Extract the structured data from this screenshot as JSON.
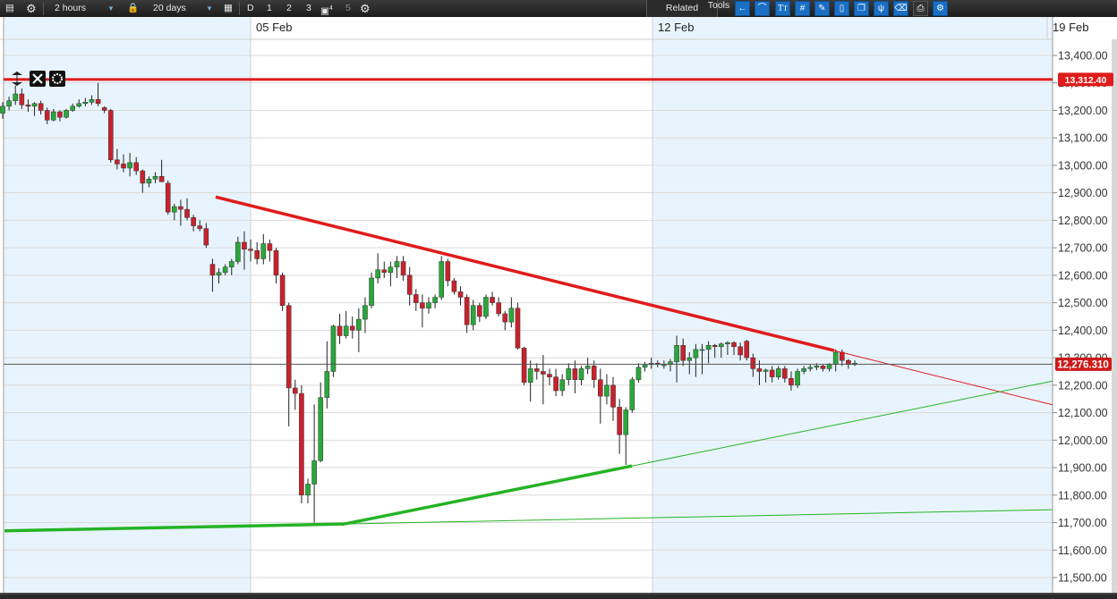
{
  "toolbar": {
    "interval": "2 hours",
    "range": "20 days",
    "period_d": "D",
    "period_1": "1",
    "period_2": "2",
    "period_3": "3",
    "period_4_sup": "4",
    "period_5": "5",
    "related": "Related",
    "tools": "Tools",
    "tool_icons": [
      "arrow-left-icon",
      "curve-icon",
      "text-tool-icon",
      "crosshair-grid-icon",
      "pencil-icon",
      "candles-icon",
      "layers-icon",
      "fork-icon",
      "eraser-icon",
      "print-icon",
      "settings-pin-icon"
    ]
  },
  "colors": {
    "bull": "#29a83a",
    "bear": "#c8222c",
    "resistance": "#e01b1b",
    "support": "#25b325",
    "shade": "#e8f4fd",
    "grid": "#dadada"
  },
  "chart_data": {
    "type": "candlestick",
    "x_labels": [
      "05 Feb",
      "12 Feb",
      "19 Feb"
    ],
    "ylim": [
      11440,
      13470
    ],
    "yticks": [
      11500,
      11600,
      11700,
      11800,
      11900,
      12000,
      12100,
      12200,
      12300,
      12400,
      12500,
      12600,
      12700,
      12800,
      12900,
      13000,
      13100,
      13200,
      13300,
      13400
    ],
    "ytick_labels": [
      "11,500.00",
      "11,600.00",
      "11,700.00",
      "11,800.00",
      "11,900.00",
      "12,000.00",
      "12,100.00",
      "12,200.00",
      "12,300.00",
      "12,400.00",
      "12,500.00",
      "12,600.00",
      "12,700.00",
      "12,800.00",
      "12,900.00",
      "13,000.00",
      "13,100.00",
      "13,200.00",
      "13,300.00",
      "13,400.00"
    ],
    "horizontal_line": {
      "value": 13312.4,
      "label": "13,312.40"
    },
    "last_price": {
      "value": 12276.31,
      "label": "12,276.310"
    },
    "candles": [
      [
        13190,
        13230,
        13170,
        13215
      ],
      [
        13215,
        13250,
        13200,
        13235
      ],
      [
        13235,
        13290,
        13220,
        13260
      ],
      [
        13260,
        13280,
        13205,
        13220
      ],
      [
        13220,
        13240,
        13195,
        13215
      ],
      [
        13215,
        13230,
        13180,
        13225
      ],
      [
        13225,
        13235,
        13185,
        13200
      ],
      [
        13200,
        13210,
        13150,
        13165
      ],
      [
        13165,
        13205,
        13160,
        13195
      ],
      [
        13195,
        13200,
        13160,
        13175
      ],
      [
        13175,
        13205,
        13170,
        13200
      ],
      [
        13200,
        13225,
        13195,
        13215
      ],
      [
        13215,
        13240,
        13210,
        13225
      ],
      [
        13225,
        13245,
        13215,
        13230
      ],
      [
        13230,
        13255,
        13220,
        13240
      ],
      [
        13240,
        13300,
        13215,
        13225
      ],
      [
        13210,
        13215,
        13190,
        13200
      ],
      [
        13200,
        13205,
        13010,
        13020
      ],
      [
        13020,
        13060,
        12985,
        13005
      ],
      [
        13005,
        13040,
        12975,
        12990
      ],
      [
        12990,
        13045,
        12960,
        13010
      ],
      [
        13010,
        13030,
        12965,
        12980
      ],
      [
        12980,
        12985,
        12900,
        12935
      ],
      [
        12935,
        12960,
        12920,
        12950
      ],
      [
        12950,
        12975,
        12935,
        12960
      ],
      [
        12960,
        13020,
        12950,
        12940
      ],
      [
        12935,
        12945,
        12820,
        12830
      ],
      [
        12830,
        12860,
        12800,
        12850
      ],
      [
        12850,
        12875,
        12780,
        12840
      ],
      [
        12840,
        12880,
        12800,
        12810
      ],
      [
        12810,
        12820,
        12760,
        12780
      ],
      [
        12780,
        12800,
        12760,
        12770
      ],
      [
        12770,
        12790,
        12700,
        12710
      ],
      [
        12640,
        12660,
        12540,
        12600
      ],
      [
        12600,
        12625,
        12570,
        12610
      ],
      [
        12610,
        12640,
        12600,
        12630
      ],
      [
        12630,
        12660,
        12600,
        12650
      ],
      [
        12650,
        12740,
        12640,
        12720
      ],
      [
        12720,
        12760,
        12620,
        12695
      ],
      [
        12695,
        12730,
        12650,
        12690
      ],
      [
        12690,
        12720,
        12640,
        12660
      ],
      [
        12660,
        12750,
        12640,
        12715
      ],
      [
        12715,
        12730,
        12650,
        12690
      ],
      [
        12690,
        12700,
        12570,
        12600
      ],
      [
        12600,
        12610,
        12470,
        12490
      ],
      [
        12490,
        12500,
        12050,
        12190
      ],
      [
        12190,
        12220,
        12110,
        12170
      ],
      [
        12170,
        12200,
        11770,
        11800
      ],
      [
        11800,
        11860,
        11770,
        11840
      ],
      [
        11840,
        12130,
        11700,
        11925
      ],
      [
        11925,
        12210,
        11920,
        12155
      ],
      [
        12155,
        12360,
        12115,
        12250
      ],
      [
        12250,
        12420,
        12230,
        12415
      ],
      [
        12415,
        12460,
        12350,
        12380
      ],
      [
        12380,
        12470,
        12370,
        12415
      ],
      [
        12415,
        12450,
        12370,
        12400
      ],
      [
        12400,
        12480,
        12320,
        12440
      ],
      [
        12440,
        12520,
        12390,
        12490
      ],
      [
        12490,
        12610,
        12480,
        12590
      ],
      [
        12590,
        12680,
        12570,
        12620
      ],
      [
        12620,
        12650,
        12590,
        12610
      ],
      [
        12610,
        12650,
        12560,
        12630
      ],
      [
        12630,
        12670,
        12590,
        12650
      ],
      [
        12650,
        12670,
        12580,
        12600
      ],
      [
        12600,
        12630,
        12490,
        12530
      ],
      [
        12530,
        12550,
        12470,
        12500
      ],
      [
        12500,
        12530,
        12410,
        12480
      ],
      [
        12480,
        12520,
        12460,
        12500
      ],
      [
        12500,
        12530,
        12480,
        12520
      ],
      [
        12520,
        12670,
        12510,
        12650
      ],
      [
        12650,
        12660,
        12560,
        12580
      ],
      [
        12580,
        12590,
        12530,
        12540
      ],
      [
        12540,
        12560,
        12490,
        12520
      ],
      [
        12520,
        12530,
        12390,
        12420
      ],
      [
        12420,
        12510,
        12400,
        12490
      ],
      [
        12490,
        12500,
        12430,
        12450
      ],
      [
        12450,
        12530,
        12440,
        12520
      ],
      [
        12520,
        12540,
        12490,
        12500
      ],
      [
        12500,
        12520,
        12450,
        12460
      ],
      [
        12460,
        12470,
        12400,
        12430
      ],
      [
        12430,
        12520,
        12410,
        12480
      ],
      [
        12480,
        12500,
        12330,
        12335
      ],
      [
        12335,
        12340,
        12200,
        12210
      ],
      [
        12210,
        12290,
        12140,
        12260
      ],
      [
        12260,
        12280,
        12220,
        12250
      ],
      [
        12250,
        12310,
        12130,
        12240
      ],
      [
        12240,
        12260,
        12200,
        12230
      ],
      [
        12230,
        12260,
        12160,
        12180
      ],
      [
        12180,
        12240,
        12160,
        12220
      ],
      [
        12220,
        12280,
        12200,
        12260
      ],
      [
        12260,
        12290,
        12170,
        12220
      ],
      [
        12220,
        12270,
        12200,
        12260
      ],
      [
        12260,
        12300,
        12240,
        12270
      ],
      [
        12270,
        12290,
        12190,
        12220
      ],
      [
        12220,
        12260,
        12060,
        12160
      ],
      [
        12160,
        12240,
        12130,
        12200
      ],
      [
        12200,
        12230,
        12070,
        12120
      ],
      [
        12120,
        12150,
        11950,
        12020
      ],
      [
        12020,
        12120,
        11910,
        12110
      ],
      [
        12110,
        12230,
        12100,
        12220
      ],
      [
        12220,
        12280,
        12210,
        12265
      ],
      [
        12265,
        12285,
        12250,
        12275
      ],
      [
        12275,
        12300,
        12260,
        12280
      ],
      [
        12280,
        12290,
        12265,
        12275
      ],
      [
        12275,
        12290,
        12260,
        12275
      ],
      [
        12275,
        12295,
        12250,
        12285
      ],
      [
        12285,
        12380,
        12210,
        12345
      ],
      [
        12345,
        12370,
        12270,
        12290
      ],
      [
        12290,
        12320,
        12240,
        12300
      ],
      [
        12300,
        12350,
        12230,
        12330
      ],
      [
        12330,
        12350,
        12240,
        12330
      ],
      [
        12330,
        12360,
        12280,
        12345
      ],
      [
        12345,
        12350,
        12300,
        12340
      ],
      [
        12340,
        12355,
        12300,
        12350
      ],
      [
        12350,
        12360,
        12310,
        12355
      ],
      [
        12355,
        12360,
        12310,
        12340
      ],
      [
        12340,
        12355,
        12290,
        12310
      ],
      [
        12360,
        12365,
        12290,
        12300
      ],
      [
        12300,
        12315,
        12230,
        12260
      ],
      [
        12260,
        12290,
        12200,
        12250
      ],
      [
        12250,
        12260,
        12210,
        12255
      ],
      [
        12255,
        12270,
        12210,
        12230
      ],
      [
        12230,
        12270,
        12220,
        12260
      ],
      [
        12260,
        12270,
        12210,
        12225
      ],
      [
        12225,
        12250,
        12180,
        12200
      ],
      [
        12200,
        12260,
        12190,
        12250
      ],
      [
        12250,
        12270,
        12240,
        12260
      ],
      [
        12260,
        12275,
        12250,
        12265
      ],
      [
        12265,
        12280,
        12255,
        12270
      ],
      [
        12270,
        12275,
        12250,
        12260
      ],
      [
        12260,
        12280,
        12250,
        12275
      ],
      [
        12275,
        12330,
        12250,
        12320
      ],
      [
        12320,
        12330,
        12270,
        12290
      ],
      [
        12290,
        12295,
        12260,
        12275
      ],
      [
        12275,
        12290,
        12270,
        12280
      ]
    ],
    "trendlines": [
      {
        "name": "resistance",
        "x1": 241,
        "y1": 12885,
        "x2": 932,
        "y2": 12326,
        "extend_to": 1176,
        "style": "bold-then-thin"
      },
      {
        "name": "support-upper",
        "x1": 385,
        "y1": 11695,
        "x2": 706,
        "y2": 11906,
        "extend_to": 1176,
        "style": "bold-then-thin"
      },
      {
        "name": "support-lower",
        "x1": 5,
        "y1": 11670,
        "x2": 385,
        "y2": 11695,
        "extend_to": 1176,
        "style": "bold-then-thin"
      }
    ]
  }
}
